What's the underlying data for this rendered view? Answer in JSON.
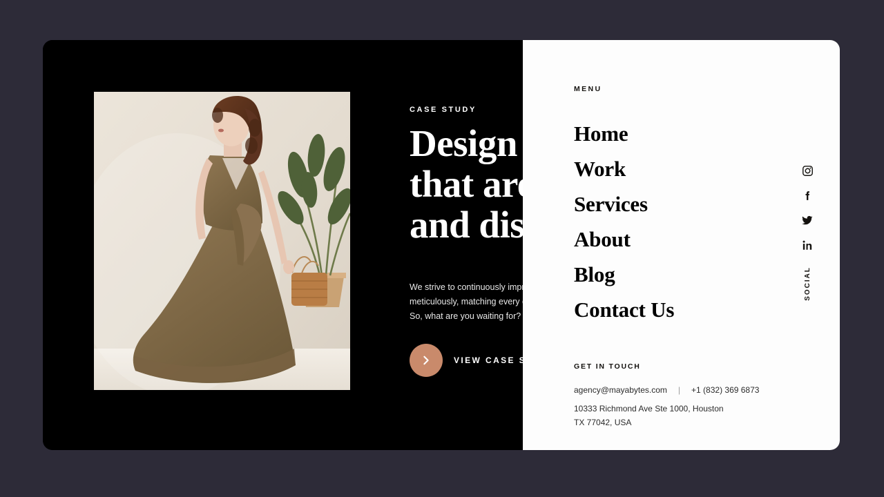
{
  "theme": {
    "page_background": "#2d2b38",
    "left_panel_background": "#000000",
    "right_panel_background": "#fdfdfd",
    "accent": "#c98a6b",
    "text_light": "#ffffff",
    "text_dark": "#14120f"
  },
  "hero": {
    "eyebrow": "CASE STUDY",
    "title_lines": [
      "Design",
      "that are",
      "and dis"
    ],
    "paragraph_lines": [
      "We strive to continuously impro",
      "meticulously, matching every el",
      "So, what are you waiting for?"
    ],
    "cta": {
      "label": "VIEW CASE STUDY",
      "icon": "chevron-right-icon"
    },
    "photo": {
      "alt": "woman-in-brown-dress-with-plant-and-rattan-bag"
    }
  },
  "menu": {
    "label": "MENU",
    "items": [
      {
        "label": "Home"
      },
      {
        "label": "Work"
      },
      {
        "label": "Services"
      },
      {
        "label": "About"
      },
      {
        "label": "Blog"
      },
      {
        "label": "Contact Us"
      }
    ]
  },
  "contact": {
    "heading": "GET IN TOUCH",
    "email": "agency@mayabytes.com",
    "separator": "|",
    "phone": "+1 (832) 369 6873",
    "address_line1": "10333 Richmond Ave Ste 1000, Houston",
    "address_line2": "TX 77042, USA"
  },
  "social": {
    "label": "SOCIAL",
    "items": [
      {
        "icon": "instagram-icon",
        "name": "Instagram"
      },
      {
        "icon": "facebook-icon",
        "name": "Facebook"
      },
      {
        "icon": "twitter-icon",
        "name": "Twitter"
      },
      {
        "icon": "linkedin-icon",
        "name": "LinkedIn"
      }
    ]
  }
}
